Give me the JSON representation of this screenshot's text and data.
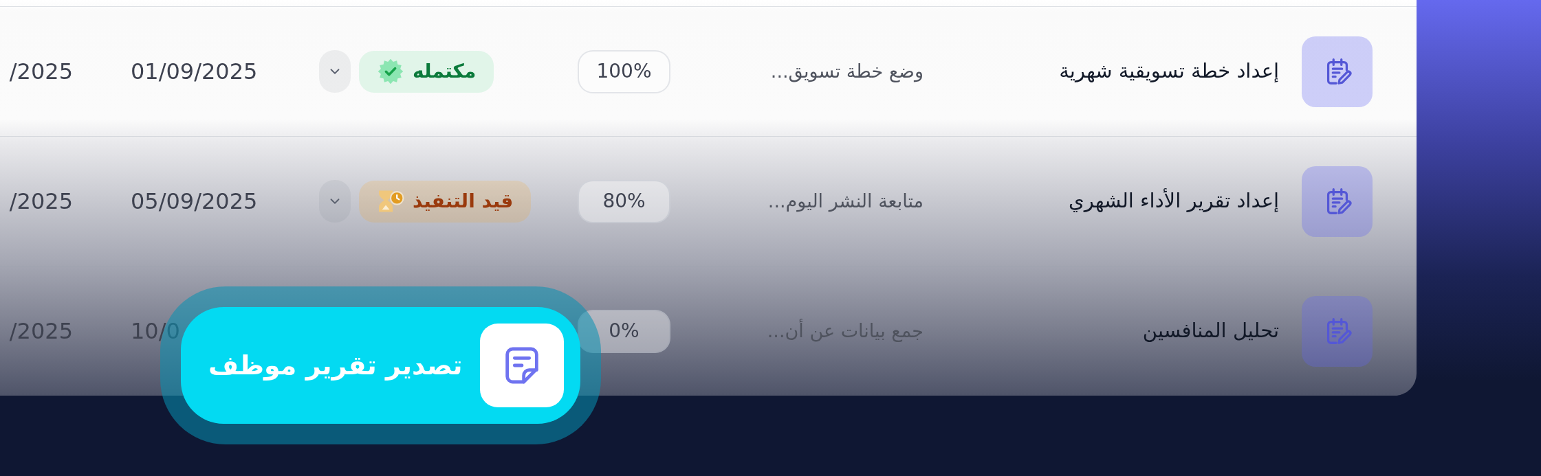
{
  "table": {
    "rows": [
      {
        "task": "إعداد خطة تسويقية شهرية",
        "description": "وضع خطة تسويق...",
        "progress": "100%",
        "status": {
          "kind": "done",
          "label": "مكتمله"
        },
        "date": "01/09/2025",
        "column_7": "/2025"
      },
      {
        "task": "إعداد تقرير الأداء الشهري",
        "description": "متابعة النشر اليوم...",
        "progress": "80%",
        "status": {
          "kind": "in_progress",
          "label": "قيد التنفيذ"
        },
        "date": "05/09/2025",
        "column_7": "/2025"
      },
      {
        "task": "تحليل المنافسين",
        "description": "جمع بيانات عن أن...",
        "progress": "0%",
        "date": "10/0",
        "column_7": "/2025"
      }
    ]
  },
  "export_button": {
    "label": "تصدير تقرير موظف"
  }
}
